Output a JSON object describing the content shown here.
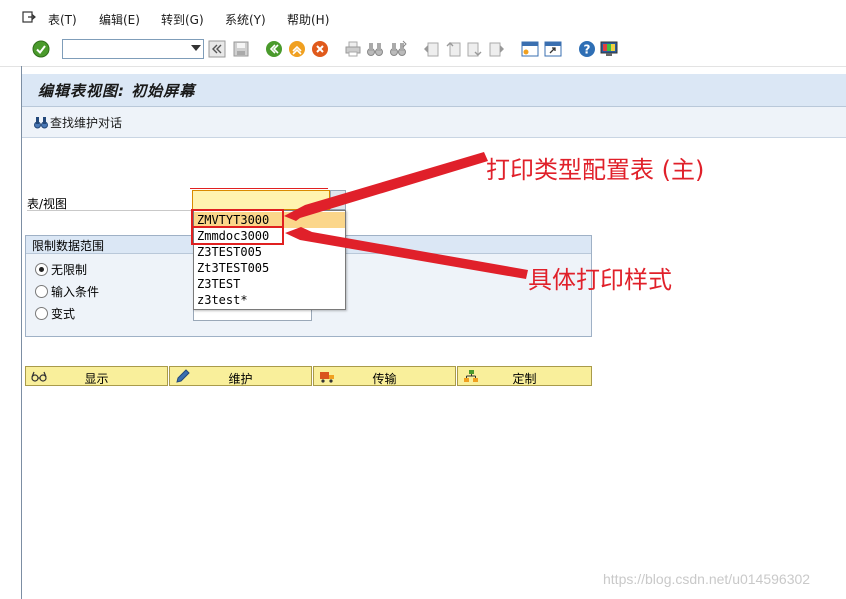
{
  "menu": {
    "items": [
      "表(T)",
      "编辑(E)",
      "转到(G)",
      "系统(Y)",
      "帮助(H)"
    ]
  },
  "toolbar": {
    "command_value": "",
    "icons": [
      "enter-icon",
      "command-dropdown-icon",
      "back-collapse-icon",
      "save-icon",
      "back-icon",
      "exit-icon",
      "cancel-icon",
      "print-icon",
      "find-icon",
      "find-next-icon",
      "first-page-icon",
      "prev-page-icon",
      "next-page-icon",
      "last-page-icon",
      "new-session-icon",
      "shortcut-icon",
      "help-icon",
      "customize-layout-icon"
    ]
  },
  "page": {
    "title": "编辑表视图: 初始屏幕"
  },
  "app_toolbar": {
    "find_label": "查找维护对话"
  },
  "form": {
    "table_view_label": "表/视图",
    "table_view_value": "",
    "restrict_group_title": "限制数据范围",
    "radios": [
      {
        "label": "无限制",
        "checked": true
      },
      {
        "label": "输入条件",
        "checked": false
      },
      {
        "label": "变式",
        "checked": false
      }
    ]
  },
  "dropdown": {
    "items": [
      "ZMVTYT3000",
      "Zmmdoc3000",
      "Z3TEST005",
      "Zt3TEST005",
      "Z3TEST",
      "z3test*"
    ],
    "selected_index": 0
  },
  "buttons": {
    "display": "显示",
    "maintain": "维护",
    "transport": "传输",
    "customize": "定制"
  },
  "annotations": {
    "config_table": "打印类型配置表 (主)",
    "print_style": "具体打印样式",
    "color": "#e0202a"
  },
  "watermark": "https://blog.csdn.net/u014596302"
}
